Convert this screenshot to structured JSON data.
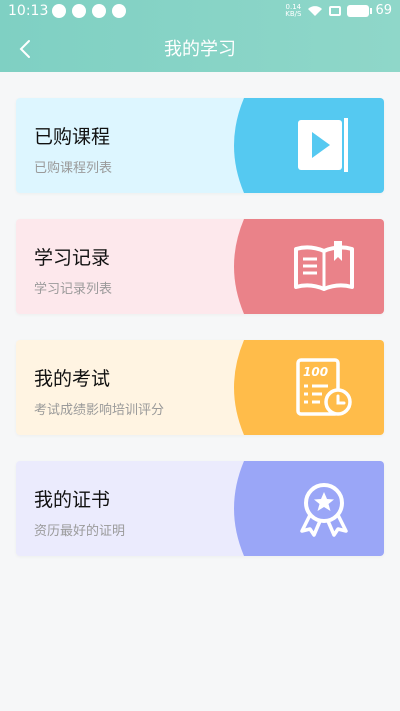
{
  "status": {
    "time": "10:13",
    "net_speed_value": "0.14",
    "net_speed_unit": "KB/S",
    "battery": "69"
  },
  "nav": {
    "title": "我的学习"
  },
  "cards": [
    {
      "title": "已购课程",
      "subtitle": "已购课程列表",
      "icon": "play-video-icon",
      "color": "#55c9f1"
    },
    {
      "title": "学习记录",
      "subtitle": "学习记录列表",
      "icon": "book-icon",
      "color": "#ea8289"
    },
    {
      "title": "我的考试",
      "subtitle": "考试成绩影响培训评分",
      "icon": "exam-score-icon",
      "color": "#ffbc4a"
    },
    {
      "title": "我的证书",
      "subtitle": "资历最好的证明",
      "icon": "certificate-badge-icon",
      "color": "#9aa6f7"
    }
  ]
}
